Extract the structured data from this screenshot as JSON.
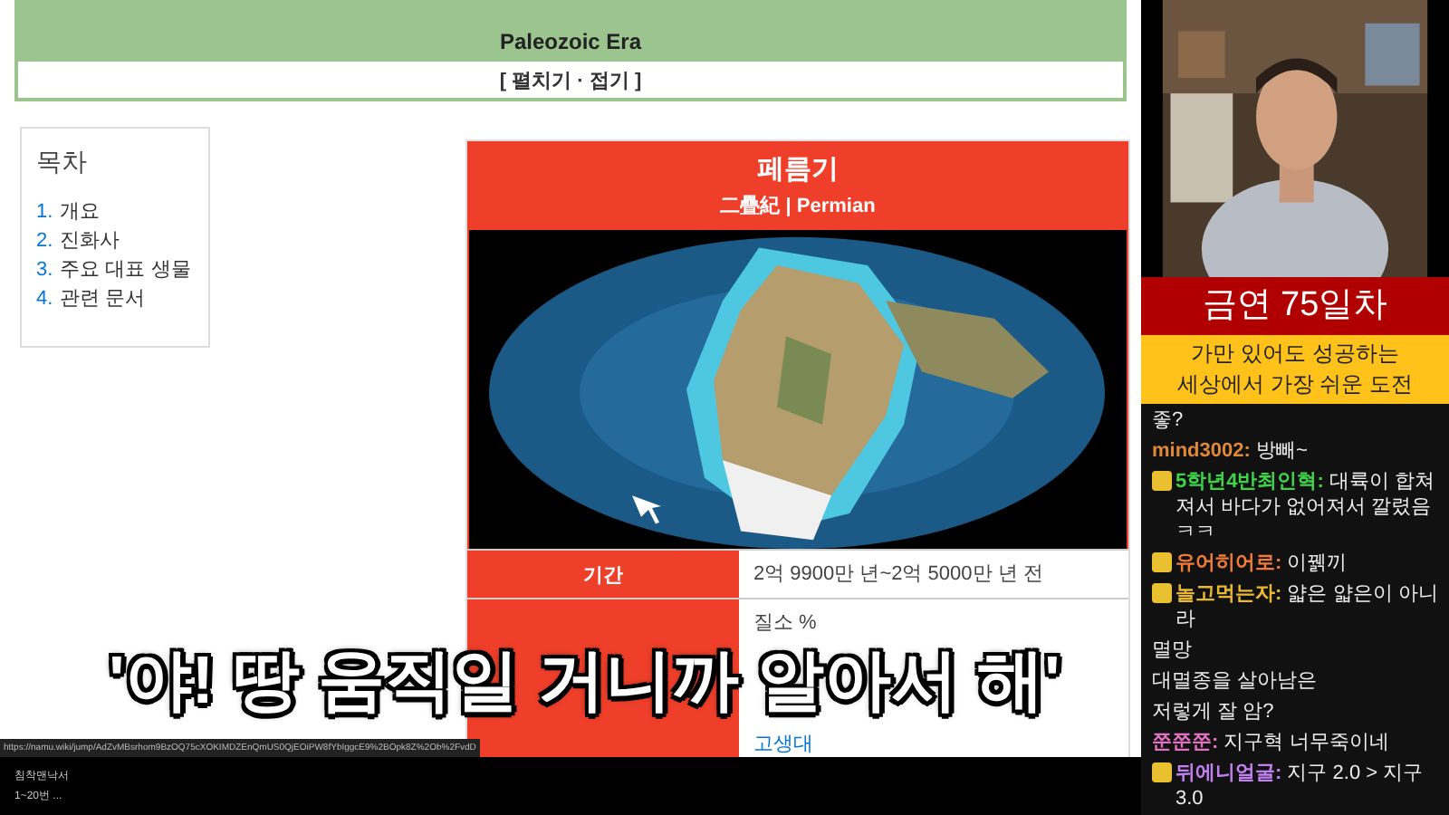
{
  "browser": {
    "era_header": {
      "subtitle": "Paleozoic Era",
      "toggle": "[ 펼치기 · 접기 ]"
    },
    "toc": {
      "title": "목차",
      "items": [
        {
          "number": "1.",
          "label": "개요"
        },
        {
          "number": "2.",
          "label": "진화사"
        },
        {
          "number": "3.",
          "label": "주요 대표 생물"
        },
        {
          "number": "4.",
          "label": "관련 문서"
        }
      ]
    },
    "infobox": {
      "title": "페름기",
      "subtitle": "二疊紀 | Permian",
      "rows": [
        {
          "label": "기간",
          "lines": [
            "2억 9900만 년~2억 5000만 년 전"
          ]
        },
        {
          "label": "",
          "lines": [
            "질소 %",
            "고생대"
          ]
        }
      ]
    },
    "status_url": "https://namu.wiki/jump/AdZvMBsrhom9BzOQ75cXOKIMDZEnQmUS0QjEOiPW8fYbIggcE9%2BOpk8Z%2Ob%2FvdD"
  },
  "taskbar": {
    "lines": [
      "침착맨낙서",
      "1~20번 ..."
    ]
  },
  "banner": {
    "title": "금연 75일차",
    "lines": [
      "가만 있어도 성공하는",
      "세상에서 가장 쉬운 도전"
    ]
  },
  "chat": [
    {
      "text": "좋?"
    },
    {
      "user": "mind3002:",
      "text": "방빼~",
      "color": "#e0883a",
      "badge": false
    },
    {
      "user": "5학년4반최인혁:",
      "text": "대륙이 합쳐져서 바다가 없어져서 깔렸음 ㅋㅋ",
      "color": "#3fd34a",
      "badge": true
    },
    {
      "user": "유어히어로:",
      "text": "이꿹끼",
      "color": "#ef7a3a",
      "badge": true
    },
    {
      "user": "놀고먹는자:",
      "text": "얇은 얇은이 아니라",
      "color": "#e8b830",
      "badge": true
    },
    {
      "text": "멸망"
    },
    {
      "text": "대멸종을 살아남은"
    },
    {
      "text": "저렇게 잘 암?"
    },
    {
      "user": "쭌쭌쭌:",
      "text": "지구혁 너무죽이네",
      "color": "#e070c0",
      "badge": false
    },
    {
      "user": "뒤에니얼굴:",
      "text": "지구 2.0 > 지구 3.0",
      "color": "#c080f0",
      "badge": true
    }
  ],
  "caption": "'야! 땅 움직일 거니까 알아서 해'"
}
